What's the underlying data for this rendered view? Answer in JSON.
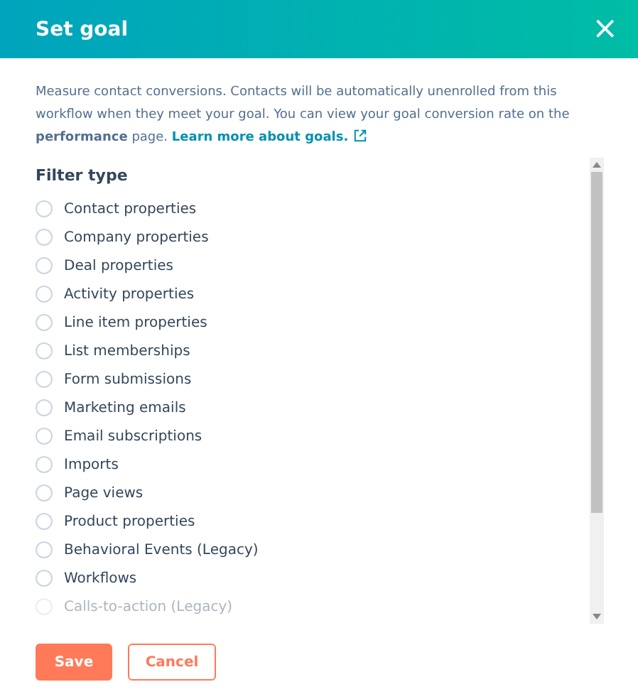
{
  "dialog": {
    "title": "Set goal",
    "close": "×"
  },
  "description": {
    "text": "Measure contact conversions. Contacts will be automatically unenrolled from this workflow when they meet your goal. You can view your goal conversion rate on the **performance** page.",
    "link": "Learn more about goals."
  },
  "filter_type": {
    "label": "Filter type",
    "options": [
      {
        "label": "Contact properties",
        "selected": false
      },
      {
        "label": "Company properties",
        "selected": false
      },
      {
        "label": "Deal properties",
        "selected": false
      },
      {
        "label": "Activity properties",
        "selected": false
      },
      {
        "label": "Line item properties",
        "selected": false
      },
      {
        "label": "List memberships",
        "selected": false
      },
      {
        "label": "Form submissions",
        "selected": false
      },
      {
        "label": "Marketing emails",
        "selected": false
      },
      {
        "label": "Email subscriptions",
        "selected": false
      },
      {
        "label": "Imports",
        "selected": false
      },
      {
        "label": "Page views",
        "selected": false
      },
      {
        "label": "Product properties",
        "selected": false
      },
      {
        "label": "Behavioral Events (Legacy)",
        "selected": false
      },
      {
        "label": "Workflows",
        "selected": false
      },
      {
        "label": "Calls-to-action (Legacy)",
        "selected": false
      }
    ]
  },
  "buttons": [
    {
      "label": "Save",
      "kind": "primary"
    },
    {
      "label": "Cancel",
      "kind": "secondary"
    }
  ]
}
